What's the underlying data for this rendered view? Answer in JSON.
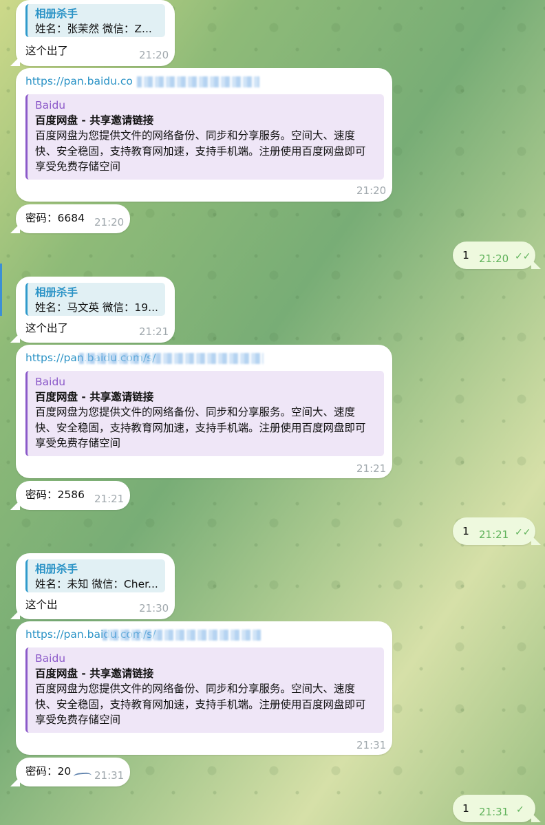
{
  "groups": [
    {
      "reply": {
        "name": "相册杀手",
        "text": "姓名：张茉然 微信：Z..."
      },
      "caption": "这个出了",
      "caption_time": "21:20",
      "link": "https://pan.baidu.co",
      "preview": {
        "site": "Baidu",
        "title": "百度网盘 - 共享邀请链接",
        "desc": "百度网盘为您提供文件的网络备份、同步和分享服务。空间大、速度快、安全稳固，支持教育网加速，支持手机端。注册使用百度网盘即可享受免费存储空间"
      },
      "link_time": "21:20",
      "password": "密码：6684",
      "password_time": "21:20",
      "out_text": "1",
      "out_time": "21:20"
    },
    {
      "reply": {
        "name": "相册杀手",
        "text": "姓名：马文英 微信：19..."
      },
      "caption": "这个出了",
      "caption_time": "21:21",
      "link": "https://pan.baidu.com/s/",
      "preview": {
        "site": "Baidu",
        "title": "百度网盘 - 共享邀请链接",
        "desc": "百度网盘为您提供文件的网络备份、同步和分享服务。空间大、速度快、安全稳固，支持教育网加速，支持手机端。注册使用百度网盘即可享受免费存储空间"
      },
      "link_time": "21:21",
      "password": "密码：2586",
      "password_time": "21:21",
      "out_text": "1",
      "out_time": "21:21"
    },
    {
      "reply": {
        "name": "相册杀手",
        "text": "姓名：未知 微信：Cher..."
      },
      "caption": "这个出",
      "caption_time": "21:30",
      "link": "https://pan.baidu.com/s/",
      "preview": {
        "site": "Baidu",
        "title": "百度网盘 - 共享邀请链接",
        "desc": "百度网盘为您提供文件的网络备份、同步和分享服务。空间大、速度快、安全稳固，支持教育网加速，支持手机端。注册使用百度网盘即可享受免费存储空间"
      },
      "link_time": "21:31",
      "password": "密码：20",
      "password_time": "21:31",
      "out_text": "1",
      "out_time": "21:31"
    }
  ],
  "icons": {
    "read_ticks": "double-check-icon",
    "sent_tick": "check-icon"
  },
  "colors": {
    "outgoing_bubble": "#eef9de",
    "link": "#2b93c6",
    "preview_accent": "#8b59c9",
    "reply_accent": "#2f9acb"
  }
}
